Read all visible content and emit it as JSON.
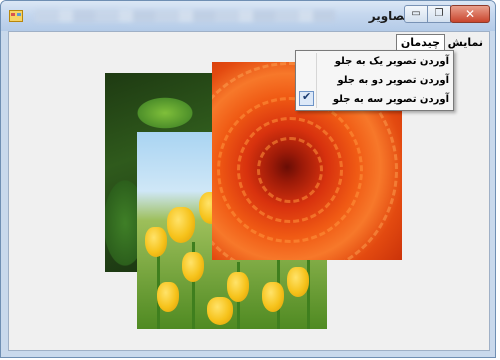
{
  "window": {
    "title": "تصاویر",
    "controls": {
      "minimize": "▭",
      "maximize": "❐",
      "close": "✕"
    },
    "icon": "app-form-icon"
  },
  "menu": {
    "items": [
      {
        "label": "نمایش"
      },
      {
        "label": "چیدمان"
      }
    ],
    "dropdown": [
      {
        "label": "آوردن تصویر یک به جلو",
        "checked": false
      },
      {
        "label": "آوردن تصویر دو به جلو",
        "checked": false
      },
      {
        "label": "آوردن تصویر سه به جلو",
        "checked": true
      }
    ],
    "check_glyph": "✔"
  },
  "pictures": [
    {
      "name": "leaf",
      "description_icon": "green-leaf-image"
    },
    {
      "name": "tulips",
      "description_icon": "yellow-tulips-image"
    },
    {
      "name": "chrysanthemum",
      "description_icon": "orange-flower-image"
    }
  ]
}
